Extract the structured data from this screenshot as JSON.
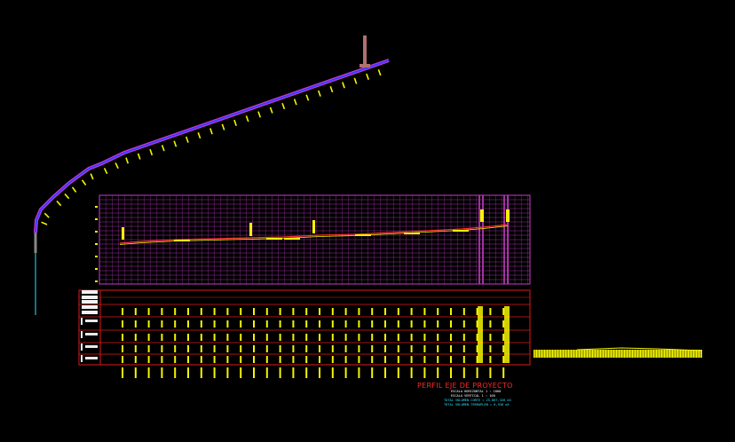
{
  "drawing": {
    "background": "#000000",
    "colors": {
      "axis_blue": "#3b3bff",
      "axis_magenta": "#d43ad4",
      "station_ticks": "#f5f500",
      "grid_magenta": "#c43cc4",
      "table_red": "#e01818",
      "profile_red": "#ff3030",
      "cyan": "#29e4ff",
      "pole": "#b07070"
    }
  },
  "title_block": {
    "title": "PERFIL EJE DE PROYECTO",
    "scale_horizontal": "ESCALA HORIZONTAL 1 : 1000",
    "scale_vertical": "ESCALA VERTICAL 1 : 100",
    "total_cut": "TOTAL VOLUMEN CORTE = 25,867,326 m3",
    "total_fill": "TOTAL VOLUMEN TERRAPLEN = 6,930 m3"
  }
}
